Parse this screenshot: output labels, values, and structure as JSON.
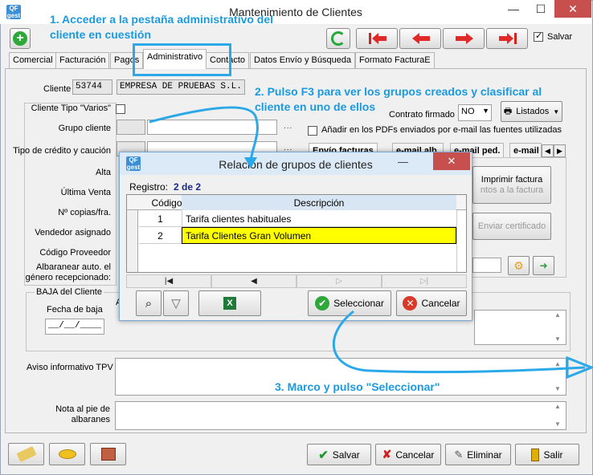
{
  "window": {
    "title": "Mantenimiento de Clientes",
    "minimize": "—",
    "maximize": "☐",
    "close": "✕",
    "logo": "QF gest"
  },
  "toolbar": {
    "guardar_label": "Salvar",
    "guardar_checked": true
  },
  "tabs": [
    "Comercial",
    "Facturación",
    "Pagos",
    "Administrativo",
    "Contacto",
    "Datos Envío y Búsqueda",
    "Formato FacturaE"
  ],
  "active_tab": "Administrativo",
  "cliente": {
    "label": "Cliente",
    "code": "53744",
    "name": "EMPRESA DE PRUEBAS S.L."
  },
  "left_fields": {
    "tipo_varios": "Cliente Tipo \"Varios\"",
    "grupo": "Grupo cliente",
    "credito": "Tipo de crédito y caución",
    "alta": "Alta",
    "ultima_venta": "Última Venta",
    "copias": "Nº copias/fra.",
    "vendedor": "Vendedor asignado",
    "proveedor": "Código Proveedor",
    "albaranear_1": "Albaranear auto. el",
    "albaranear_2": "género recepcionado:",
    "dots": "..."
  },
  "right": {
    "contrato_label": "Contrato firmado",
    "contrato_value": "NO",
    "listados_label": "Listados",
    "pdf_label": "Añadir en los PDFs enviados por e-mail las fuentes utilizadas",
    "subtabs": [
      "Envío facturas",
      "e-mail alb.",
      "e-mail ped.",
      "e-mail"
    ],
    "imprimir_factura": "Imprimir factura",
    "adjuntos": "ntos a la factura",
    "enviar_cert": "Enviar certificado"
  },
  "baja": {
    "title": "BAJA del Cliente",
    "fecha_label": "Fecha de baja",
    "fecha_value": "__/__/____",
    "motivo_partial": "A"
  },
  "aviso_label": "Aviso informativo TPV",
  "nota_1": "Nota al pie de",
  "nota_2": "albaranes",
  "bottom": {
    "salvar": "Salvar",
    "cancelar": "Cancelar",
    "eliminar": "Eliminar",
    "salir": "Salir"
  },
  "dialog": {
    "title": "Relacion de grupos de clientes",
    "registro_label": "Registro:",
    "registro_value": "2 de 2",
    "col_codigo": "Código",
    "col_desc": "Descripción",
    "rows": [
      {
        "codigo": "1",
        "desc": "Tarifa clientes habituales"
      },
      {
        "codigo": "2",
        "desc": "Tarifa Clientes Gran Volumen"
      }
    ],
    "nav": [
      "|◀",
      "◀",
      "▷",
      "▷|"
    ],
    "seleccionar": "Seleccionar",
    "cancelar": "Cancelar",
    "minimize": "—",
    "close": "✕"
  },
  "notes": {
    "n1_a": "1. Acceder a la pestaña administrativo del",
    "n1_b": "cliente en cuestión",
    "n2_a": "2. Pulso F3 para ver los grupos creados y clasificar al",
    "n2_b": "cliente en uno de ellos",
    "n3": "3. Marco y pulso \"Seleccionar\""
  }
}
